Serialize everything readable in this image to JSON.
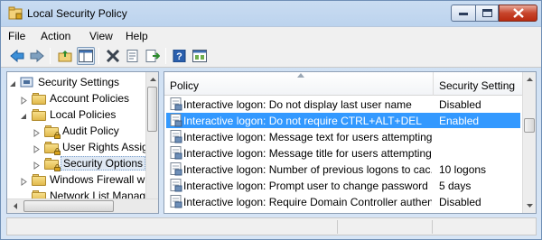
{
  "window": {
    "title": "Local Security Policy"
  },
  "menu": {
    "items": [
      "File",
      "Action",
      "View",
      "Help"
    ]
  },
  "toolbar": {
    "buttons": [
      "back-icon",
      "forward-icon",
      "up-folder-icon",
      "show-hide-tree-icon",
      "delete-icon",
      "properties-icon",
      "export-list-icon",
      "help-icon",
      "console-tree-icon"
    ]
  },
  "tree": {
    "root": "Security Settings",
    "items": [
      {
        "label": "Security Settings"
      },
      {
        "label": "Account Policies"
      },
      {
        "label": "Local Policies"
      },
      {
        "label": "Audit Policy"
      },
      {
        "label": "User Rights Assig"
      },
      {
        "label": "Security Options"
      },
      {
        "label": "Windows Firewall wit"
      },
      {
        "label": "Network List Manage"
      }
    ],
    "selected": "Security Options"
  },
  "list": {
    "headers": {
      "policy": "Policy",
      "setting": "Security Setting"
    },
    "rows": [
      {
        "policy": "Interactive logon: Do not display last user name",
        "setting": "Disabled"
      },
      {
        "policy": "Interactive logon: Do not require CTRL+ALT+DEL",
        "setting": "Enabled"
      },
      {
        "policy": "Interactive logon: Message text for users attempting ...",
        "setting": ""
      },
      {
        "policy": "Interactive logon: Message title for users attempting ...",
        "setting": ""
      },
      {
        "policy": "Interactive logon: Number of previous logons to cac...",
        "setting": "10 logons"
      },
      {
        "policy": "Interactive logon: Prompt user to change password ...",
        "setting": "5 days"
      },
      {
        "policy": "Interactive logon: Require Domain Controller authen...",
        "setting": "Disabled"
      }
    ],
    "selected_index": 1
  },
  "colors": {
    "selection": "#3399ff",
    "title_gradient": "#bcd3ee"
  }
}
